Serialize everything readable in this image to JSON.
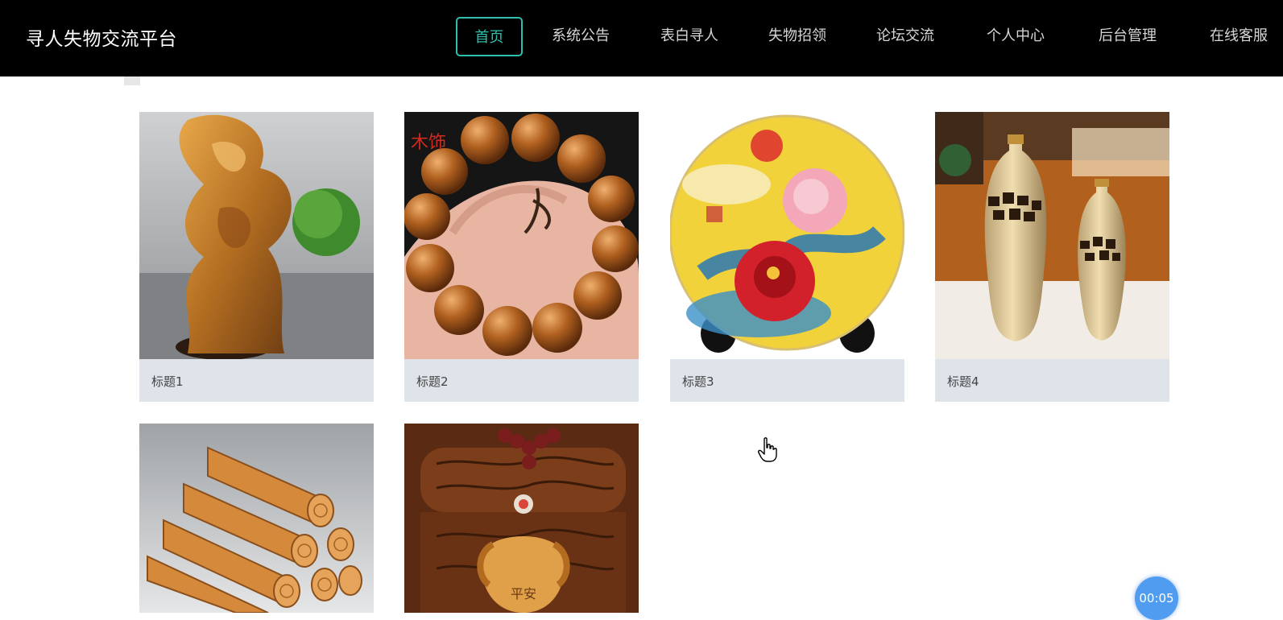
{
  "header": {
    "site_title": "寻人失物交流平台",
    "nav": [
      {
        "label": "首页",
        "active": true
      },
      {
        "label": "系统公告",
        "active": false
      },
      {
        "label": "表白寻人",
        "active": false
      },
      {
        "label": "失物招领",
        "active": false
      },
      {
        "label": "论坛交流",
        "active": false
      },
      {
        "label": "个人中心",
        "active": false
      },
      {
        "label": "后台管理",
        "active": false
      },
      {
        "label": "在线客服",
        "active": false
      }
    ],
    "accent_color": "#2fbfae",
    "background_color": "#000000"
  },
  "cards": [
    {
      "title": "标题1",
      "image": "wooden-carving"
    },
    {
      "title": "标题2",
      "image": "wood-bead-bracelet",
      "watermark": "木饰"
    },
    {
      "title": "标题3",
      "image": "peony-porcelain-plate"
    },
    {
      "title": "标题4",
      "image": "gold-ceramic-vases"
    },
    {
      "title": "",
      "image": "bamboo-scrolls"
    },
    {
      "title": "",
      "image": "wooden-treasure-chest",
      "engraving": "平安"
    }
  ],
  "timer": {
    "value": "00:05",
    "color": "#4f9cf0"
  }
}
